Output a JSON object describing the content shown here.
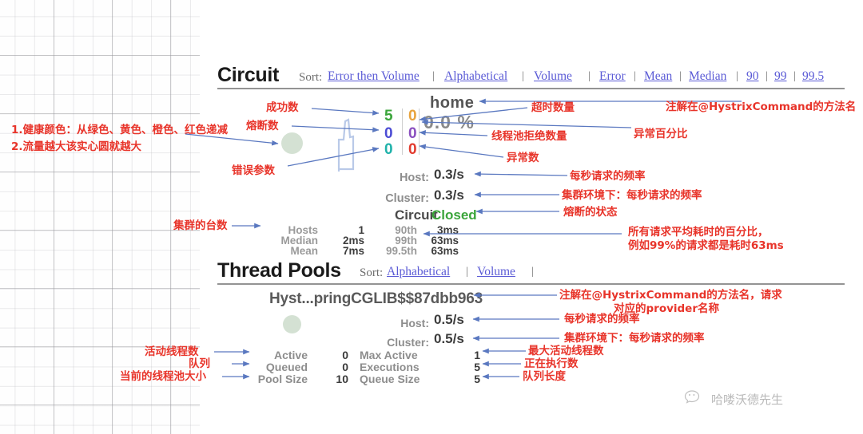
{
  "circuit": {
    "title": "Circuit",
    "sort_label": "Sort:",
    "sort_options": [
      "Error then Volume",
      "Alphabetical",
      "Volume",
      "Error",
      "Mean",
      "Median",
      "90",
      "99",
      "99.5"
    ],
    "separator": "|",
    "name": "home",
    "error_percent": "0.0 %",
    "counters_left": [
      {
        "value": "5",
        "color": "#3ba53b",
        "meaning": "success-count"
      },
      {
        "value": "0",
        "color": "#4c4cd4",
        "meaning": "short-circuited-count"
      },
      {
        "value": "0",
        "color": "#20b2aa",
        "meaning": "bad-request-count"
      }
    ],
    "counters_right": [
      {
        "value": "0",
        "color": "#e8a33d",
        "meaning": "timeout-count"
      },
      {
        "value": "0",
        "color": "#8a4fbf",
        "meaning": "threadpool-rejected-count"
      },
      {
        "value": "0",
        "color": "#e23b2e",
        "meaning": "failure-count"
      }
    ],
    "host_label": "Host:",
    "host_value": "0.3/s",
    "cluster_label": "Cluster:",
    "cluster_value": "0.3/s",
    "circuit_word": "Circuit",
    "circuit_state": "Closed",
    "stats": [
      {
        "label": "Hosts",
        "value": "1",
        "lat_label": "90th",
        "lat_value": "3ms"
      },
      {
        "label": "Median",
        "value": "2ms",
        "lat_label": "99th",
        "lat_value": "63ms"
      },
      {
        "label": "Mean",
        "value": "7ms",
        "lat_label": "99.5th",
        "lat_value": "63ms"
      }
    ]
  },
  "thread_pools": {
    "title": "Thread Pools",
    "sort_label": "Sort:",
    "sort_options": [
      "Alphabetical",
      "Volume"
    ],
    "separator": "|",
    "pool_name": "Hyst...pringCGLIB$$87dbb963",
    "host_label": "Host:",
    "host_value": "0.5/s",
    "cluster_label": "Cluster:",
    "cluster_value": "0.5/s",
    "stats_left": [
      {
        "label": "Active",
        "value": "0"
      },
      {
        "label": "Queued",
        "value": "0"
      },
      {
        "label": "Pool Size",
        "value": "10"
      }
    ],
    "stats_right": [
      {
        "label": "Max Active",
        "value": "1"
      },
      {
        "label": "Executions",
        "value": "5"
      },
      {
        "label": "Queue Size",
        "value": "5"
      }
    ]
  },
  "annotations": {
    "health_color": "1.健康颜色：从绿色、黄色、橙色、红色递减",
    "bubble_size": "2.流量越大该实心圆就越大",
    "success_count": "成功数",
    "circuit_break_count": "熔断数",
    "error_param": "错误参数",
    "timeout_count": "超时数量",
    "method_name": "注解在@HystrixCommand的方法名",
    "error_percent": "异常百分比",
    "threadpool_rejected": "线程池拒绝数量",
    "exception_count": "异常数",
    "request_rate": "每秒请求的频率",
    "cluster_request_rate": "集群环境下：每秒请求的频率",
    "circuit_state": "熔断的状态",
    "cluster_hosts": "集群的台数",
    "latency_percentile_line1": "所有请求平均耗时的百分比，",
    "latency_percentile_line2": "例如99%的请求都是耗时63ms",
    "tp_method_name_line1": "注解在@HystrixCommand的方法名，请求",
    "tp_method_name_line2": "对应的provider名称",
    "tp_request_rate": "每秒请求的频率",
    "tp_cluster_request_rate": "集群环境下：每秒请求的频率",
    "active_threads": "活动线程数",
    "queue": "队列",
    "pool_size": "当前的线程池大小",
    "max_active_threads": "最大活动线程数",
    "executions": "正在执行数",
    "queue_length": "队列长度"
  },
  "watermark": {
    "icon": "wechat-icon",
    "text": "哈喽沃德先生"
  }
}
